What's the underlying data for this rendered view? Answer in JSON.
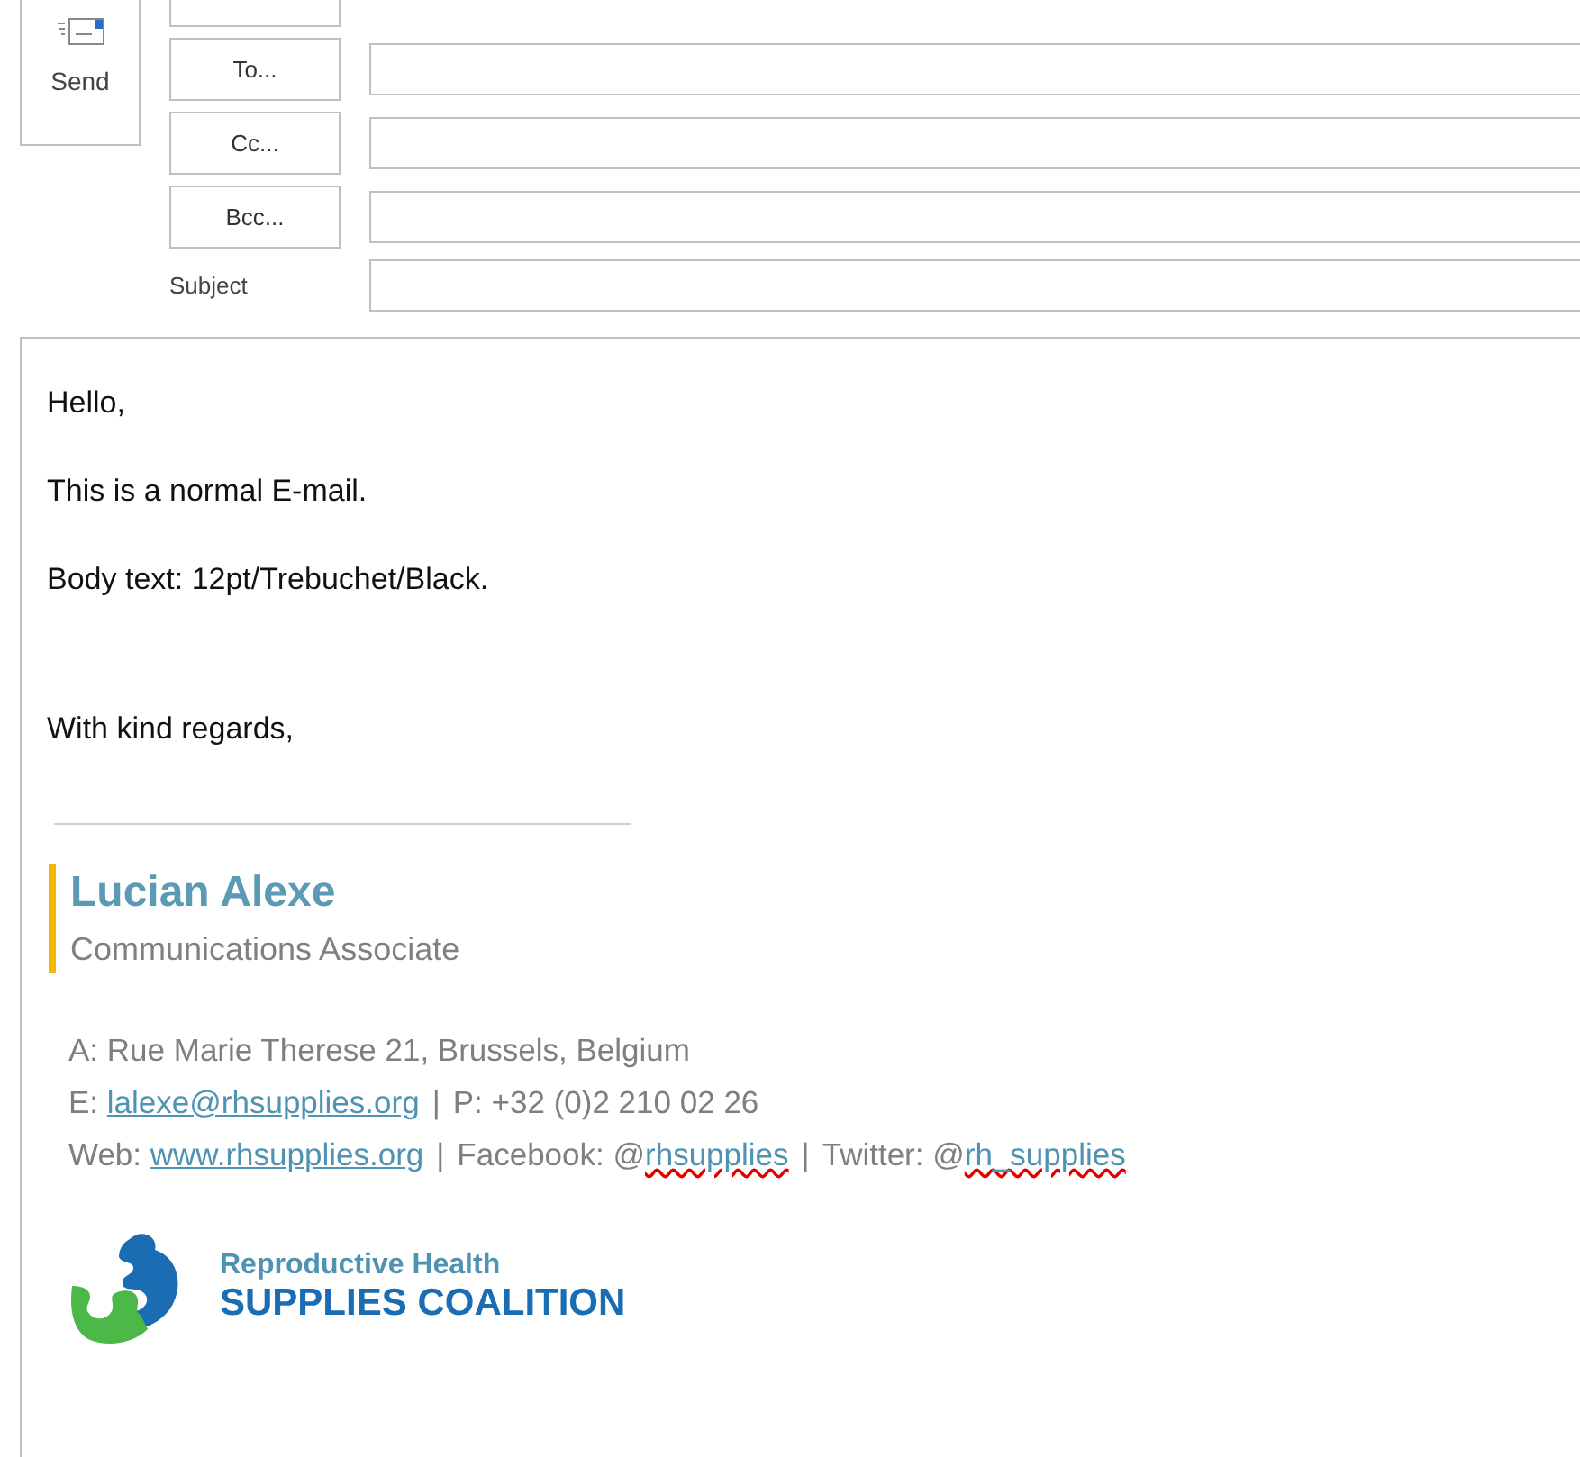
{
  "send_button": {
    "label": "Send"
  },
  "address_rows": [
    {
      "button": "To..."
    },
    {
      "button": "Cc..."
    },
    {
      "button": "Bcc..."
    }
  ],
  "subject": {
    "label": "Subject"
  },
  "body": {
    "paragraphs": [
      "Hello,",
      "This is a normal E-mail.",
      "Body text: 12pt/Trebuchet/Black."
    ],
    "closing": "With kind regards,"
  },
  "signature": {
    "name": "Lucian Alexe",
    "title": "Communications Associate",
    "lines": [
      [
        {
          "kind": "text",
          "text": "A: Rue Marie Therese 21, Brussels, Belgium"
        }
      ],
      [
        {
          "kind": "text",
          "text": "E: "
        },
        {
          "kind": "link",
          "text": "lalexe@rhsupplies.org"
        },
        {
          "kind": "sep",
          "text": "|"
        },
        {
          "kind": "text",
          "text": "P: +32 (0)2 210 02 26"
        }
      ],
      [
        {
          "kind": "text",
          "text": "Web: "
        },
        {
          "kind": "link",
          "text": "www.rhsupplies.org"
        },
        {
          "kind": "sep",
          "text": "|"
        },
        {
          "kind": "text",
          "text": "Facebook: @"
        },
        {
          "kind": "misspelled",
          "text": "rhsupplies"
        },
        {
          "kind": "sep",
          "text": "|"
        },
        {
          "kind": "text",
          "text": "Twitter: @"
        },
        {
          "kind": "misspelled",
          "text": "rh_supplies"
        }
      ]
    ],
    "logo": {
      "line_1": "Reproductive Health",
      "line_2": "SUPPLIES COALITION"
    }
  }
}
